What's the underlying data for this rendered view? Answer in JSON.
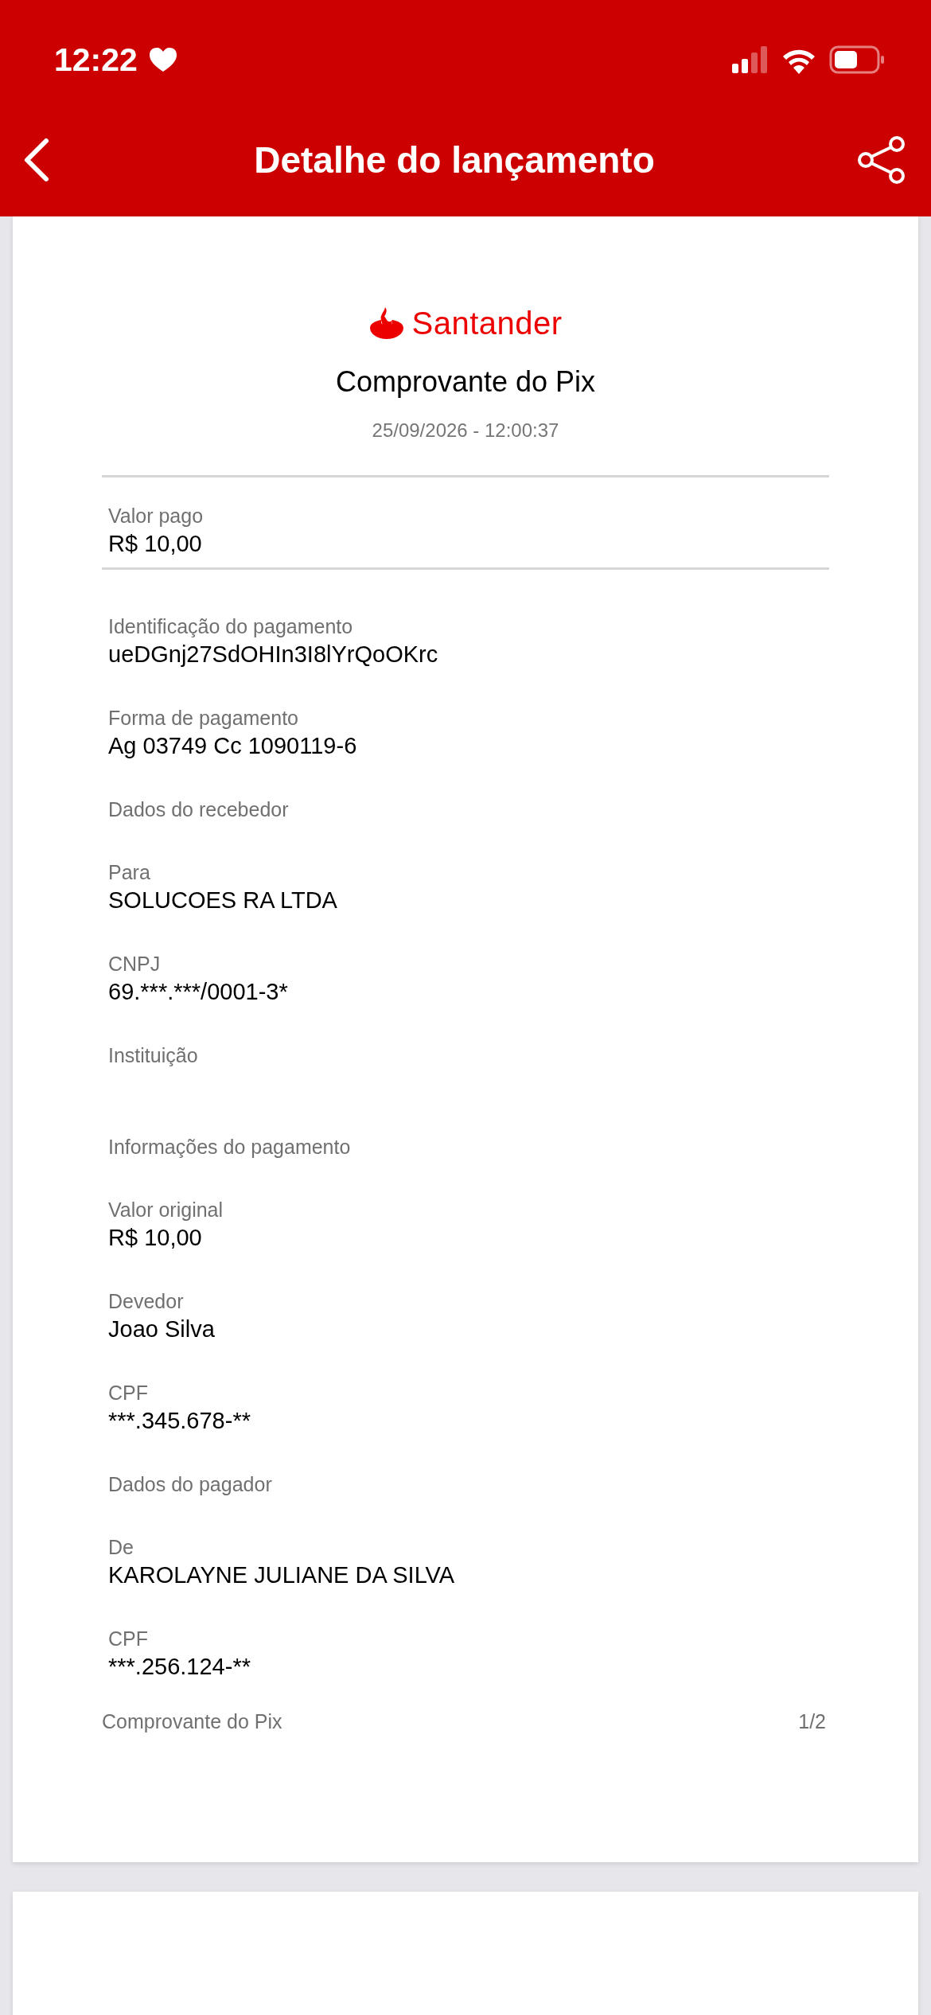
{
  "status_bar": {
    "time": "12:22"
  },
  "nav": {
    "title": "Detalhe do lançamento"
  },
  "receipt": {
    "brand": "Santander",
    "title": "Comprovante do Pix",
    "datetime": "25/09/2026 - 12:00:37",
    "amount": {
      "label": "Valor pago",
      "value": "R$ 10,00"
    },
    "items": [
      {
        "kind": "field",
        "label": "Identificação do pagamento",
        "value": "ueDGnj27SdOHIn3I8lYrQoOKrc"
      },
      {
        "kind": "field",
        "label": "Forma de pagamento",
        "value": "Ag 03749 Cc 1090119-6"
      },
      {
        "kind": "heading",
        "label": "Dados do recebedor"
      },
      {
        "kind": "field",
        "label": "Para",
        "value": "SOLUCOES RA LTDA"
      },
      {
        "kind": "field",
        "label": "CNPJ",
        "value": "69.***.***/0001-3*"
      },
      {
        "kind": "field",
        "label": "Instituição"
      },
      {
        "kind": "heading",
        "label": "Informações do pagamento"
      },
      {
        "kind": "field",
        "label": "Valor original",
        "value": "R$ 10,00"
      },
      {
        "kind": "field",
        "label": "Devedor",
        "value": "Joao Silva"
      },
      {
        "kind": "field",
        "label": "CPF",
        "value": "***.345.678-**"
      },
      {
        "kind": "heading",
        "label": "Dados do pagador"
      },
      {
        "kind": "field",
        "label": "De",
        "value": "KAROLAYNE JULIANE DA SILVA"
      },
      {
        "kind": "field",
        "label": "CPF",
        "value": "***.256.124-**"
      }
    ],
    "footer": {
      "title": "Comprovante do Pix",
      "page": "1/2"
    }
  }
}
